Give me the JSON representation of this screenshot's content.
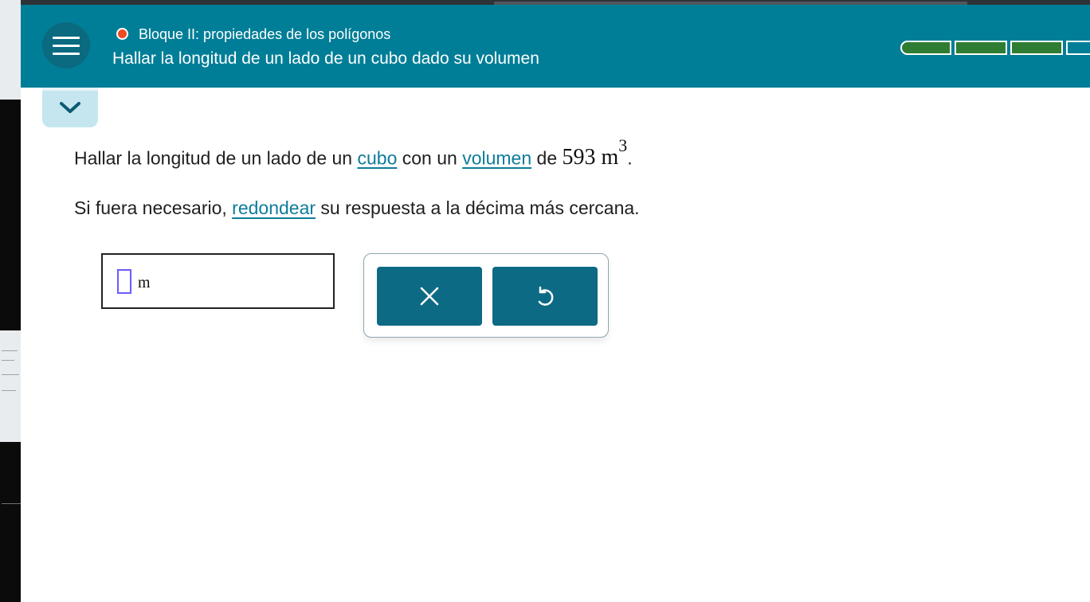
{
  "header": {
    "topic": "Bloque II: propiedades de los polígonos",
    "lesson_title": "Hallar la longitud de un lado de un cubo dado su volumen",
    "status_color": "#ef4a23",
    "progress": {
      "segments_total": 4,
      "segments_filled": 3
    },
    "icons": {
      "menu": "hamburger-menu-icon",
      "status": "status-dot-icon"
    }
  },
  "collapse": {
    "icon": "chevron-down-icon"
  },
  "question": {
    "line1_pre": "Hallar la longitud de un lado de un ",
    "link_cubo": "cubo",
    "line1_mid": " con un ",
    "link_volumen": "volumen",
    "line1_post": " de ",
    "volume_value": "593",
    "volume_unit": "m",
    "volume_exponent": "3",
    "line1_end": ".",
    "line2_pre": "Si fuera necesario, ",
    "link_redondear": "redondear",
    "line2_post": " su respuesta a la décima más cercana."
  },
  "answer": {
    "value": "",
    "unit": "m"
  },
  "buttons": {
    "clear_icon": "close-x-icon",
    "undo_icon": "undo-icon"
  },
  "colors": {
    "header": "#007e97",
    "button": "#0d6a84",
    "link": "#0e7c9b",
    "progress": "#2e7d32"
  }
}
